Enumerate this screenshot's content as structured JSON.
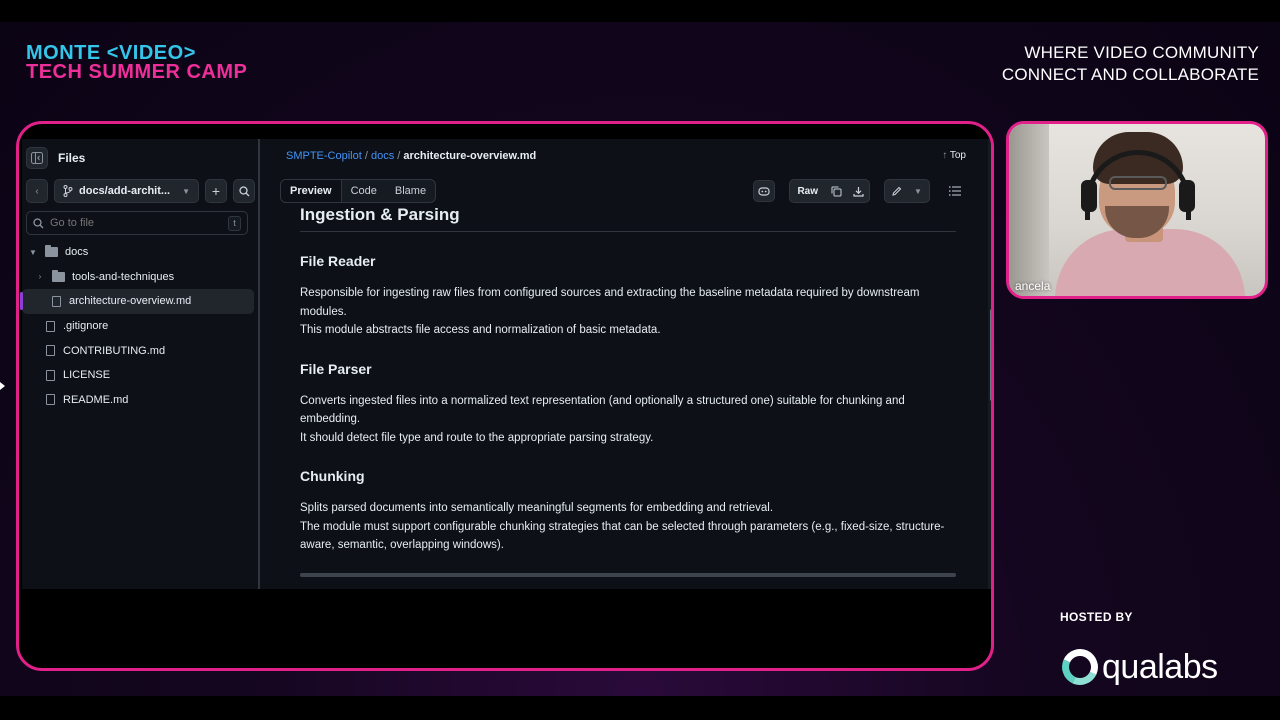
{
  "event": {
    "logo_line1": "MONTE <VIDEO>",
    "logo_line2": "TECH SUMMER CAMP",
    "tagline_line1": "WHERE VIDEO COMMUNITY",
    "tagline_line2": "CONNECT AND COLLABORATE",
    "hosted_by": "HOSTED BY",
    "host_name": "qualabs",
    "brand_colors": {
      "cyan": "#33c6ea",
      "magenta": "#ee2f9a",
      "frame": "#e2208a"
    }
  },
  "camera": {
    "name_label": "ancela"
  },
  "sidebar": {
    "title": "Files",
    "toggle_icon": "sidebar-toggle-icon",
    "branch": "docs/add-archit...",
    "goto_placeholder": "Go to file",
    "goto_shortcut": "t",
    "tree": [
      {
        "label": "docs",
        "type": "folder",
        "expanded": true
      },
      {
        "label": "tools-and-techniques",
        "type": "folder",
        "expanded": false
      },
      {
        "label": "architecture-overview.md",
        "type": "file",
        "selected": true
      },
      {
        "label": ".gitignore",
        "type": "file"
      },
      {
        "label": "CONTRIBUTING.md",
        "type": "file"
      },
      {
        "label": "LICENSE",
        "type": "file"
      },
      {
        "label": "README.md",
        "type": "file"
      }
    ]
  },
  "file": {
    "breadcrumb": {
      "repo": "SMPTE-Copilot",
      "sep1": " / ",
      "folder": "docs",
      "sep2": " / ",
      "file": "architecture-overview.md"
    },
    "top_label": "Top",
    "tabs": [
      "Preview",
      "Code",
      "Blame"
    ],
    "raw_label": "Raw"
  },
  "doc": {
    "h_ingestion": "Ingestion & Parsing",
    "h_reader": "File Reader",
    "p_reader_1": "Responsible for ingesting raw files from configured sources and extracting the baseline metadata required by downstream modules.",
    "p_reader_2": "This module abstracts file access and normalization of basic metadata.",
    "h_parser": "File Parser",
    "p_parser_1": "Converts ingested files into a normalized text representation (and optionally a structured one) suitable for chunking and embedding.",
    "p_parser_2": "It should detect file type and route to the appropriate parsing strategy.",
    "h_chunking": "Chunking",
    "p_chunk_1": "Splits parsed documents into semantically meaningful segments for embedding and retrieval.",
    "p_chunk_2": "The module must support configurable chunking strategies that can be selected through parameters (e.g., fixed-size, structure-aware, semantic, overlapping windows)."
  }
}
